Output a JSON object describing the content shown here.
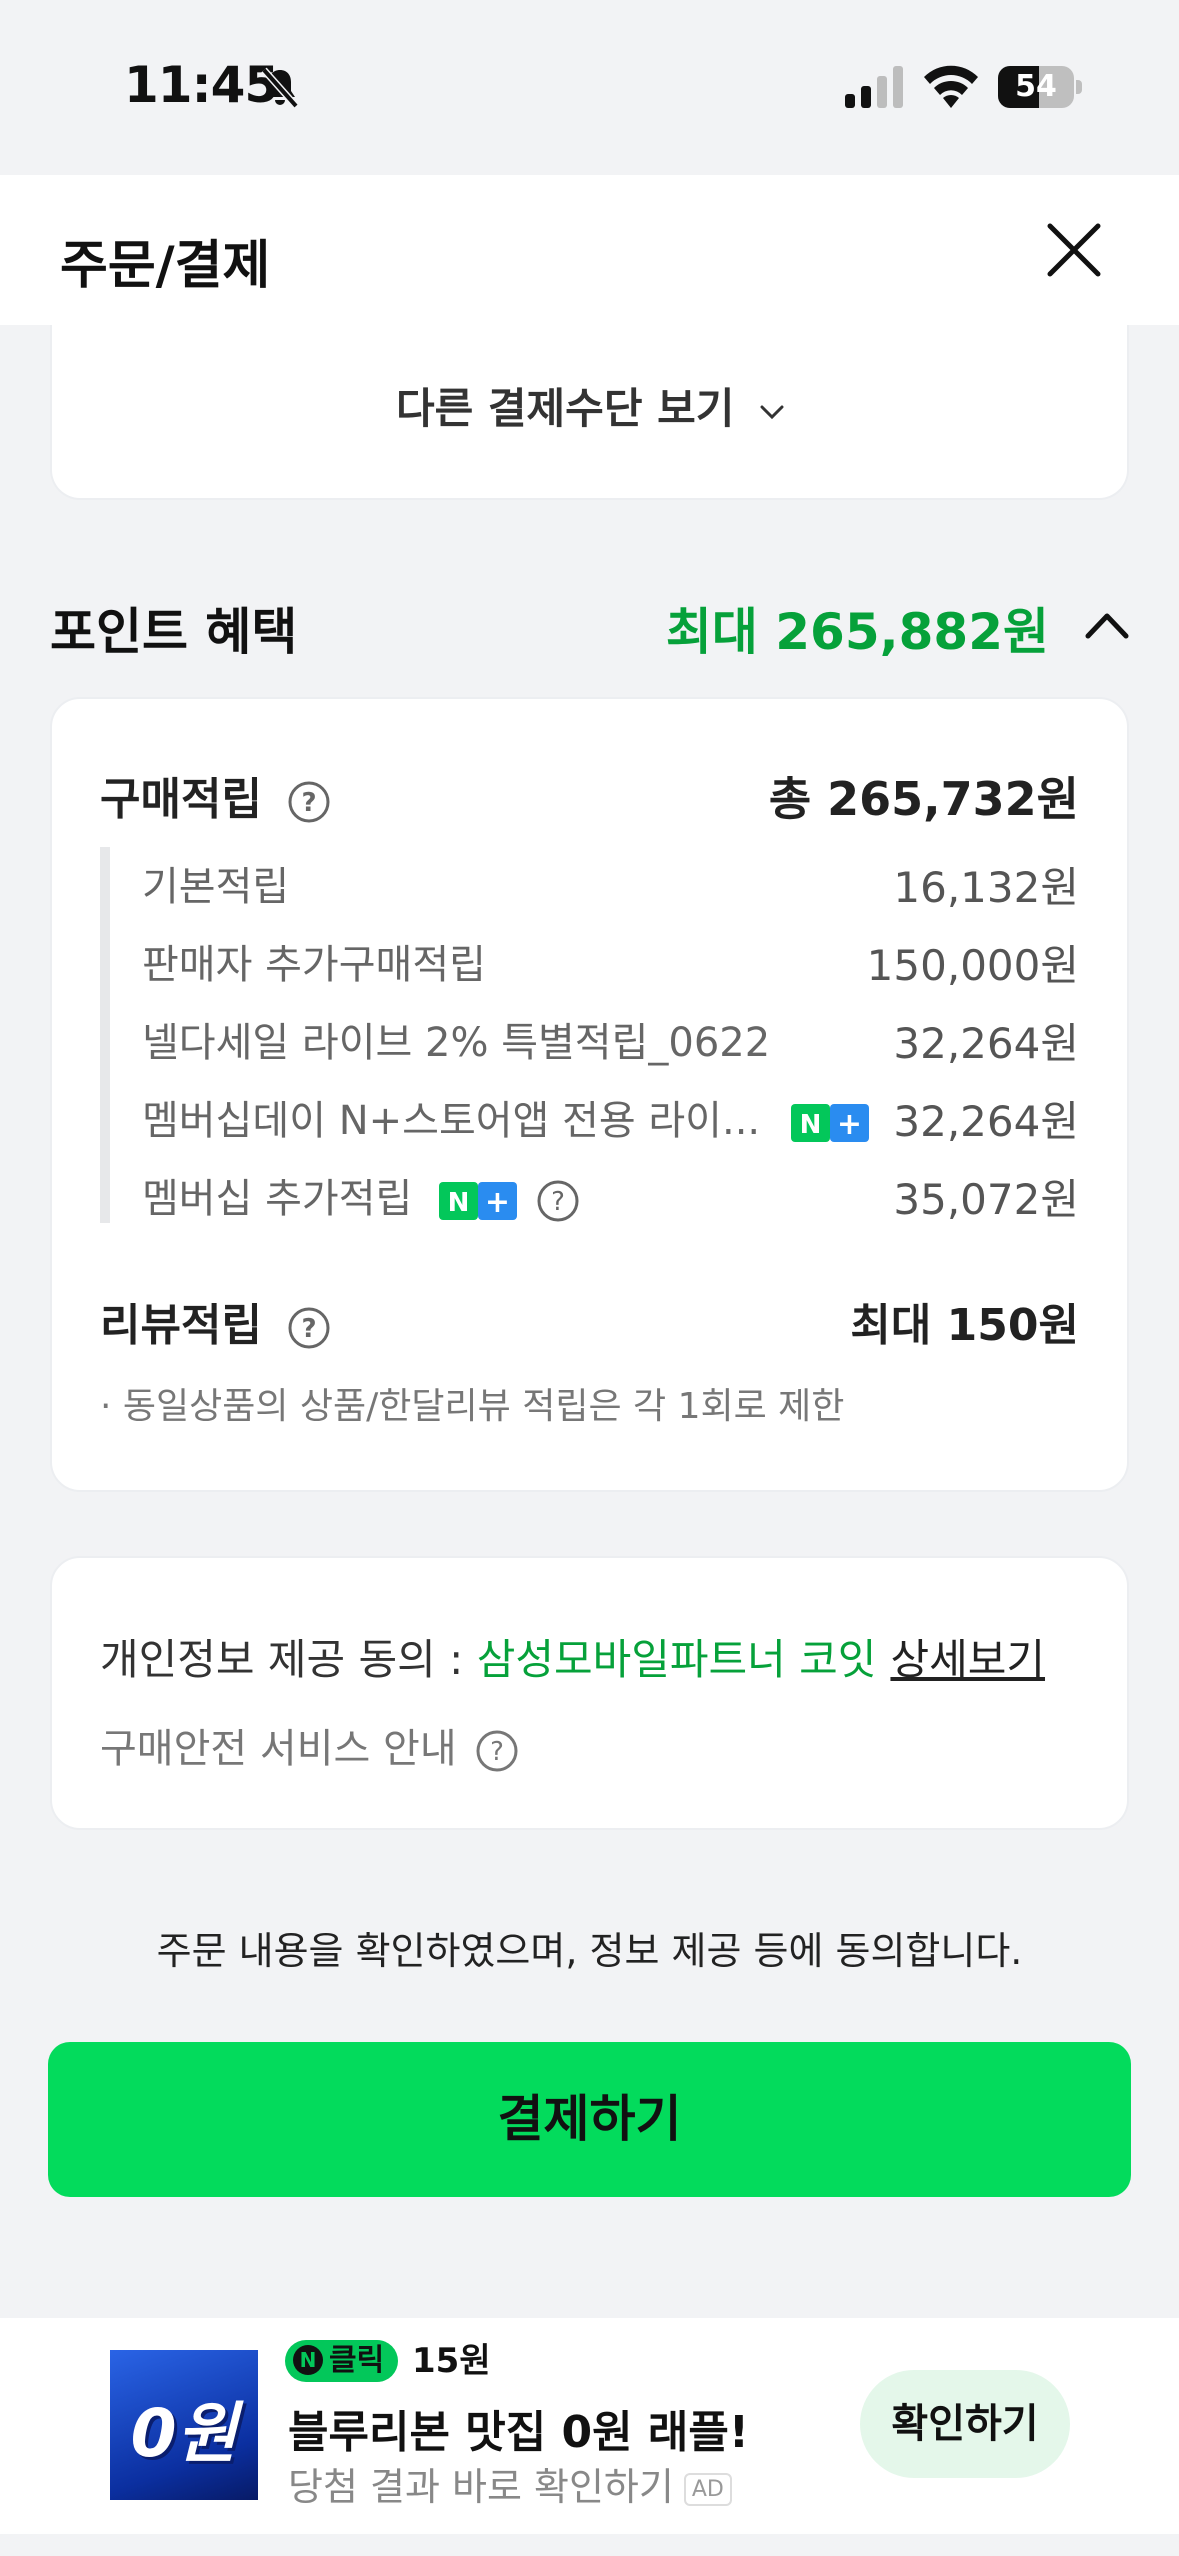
{
  "status_bar": {
    "time": "11:45",
    "battery": "54",
    "battery_level": 0.54
  },
  "header": {
    "title": "주문/결제"
  },
  "payment": {
    "other_methods_label": "다른 결제수단 보기"
  },
  "points": {
    "title": "포인트 혜택",
    "max_label": "최대 265,882원",
    "purchase": {
      "label": "구매적립",
      "total": "총 265,732원",
      "items": [
        {
          "label": "기본적립",
          "value": "16,132원"
        },
        {
          "label": "판매자 추가구매적립",
          "value": "150,000원"
        },
        {
          "label": "넬다세일 라이브 2% 특별적립_0622",
          "value": "32,264원"
        },
        {
          "label": "멤버십데이 N+스토어앱 전용 라이...",
          "value": "32,264원"
        },
        {
          "label": "멤버십 추가적립",
          "value": "35,072원"
        }
      ]
    },
    "review": {
      "label": "리뷰적립",
      "value": "최대 150원",
      "note": "· 동일상품의 상품/한달리뷰 적립은 각 1회로 제한"
    }
  },
  "consent": {
    "prefix": "개인정보 제공 동의 : ",
    "company": "삼성모바일파트너 코잇",
    "detail_link": "상세보기",
    "safe_service": "구매안전 서비스 안내"
  },
  "agree_text": "주문 내용을 확인하였으며, 정보 제공 등에 동의합니다.",
  "pay_button": "결제하기",
  "ad": {
    "thumb_text": "0원",
    "badge": "클릭",
    "reward": "15원",
    "title": "블루리본 맛집 0원 래플!",
    "subtitle": "당첨 결과 바로 확인하기",
    "tag": "AD",
    "button": "확인하기"
  },
  "colors": {
    "accent_green": "#06a13a",
    "pay_button": "#03db5c"
  }
}
